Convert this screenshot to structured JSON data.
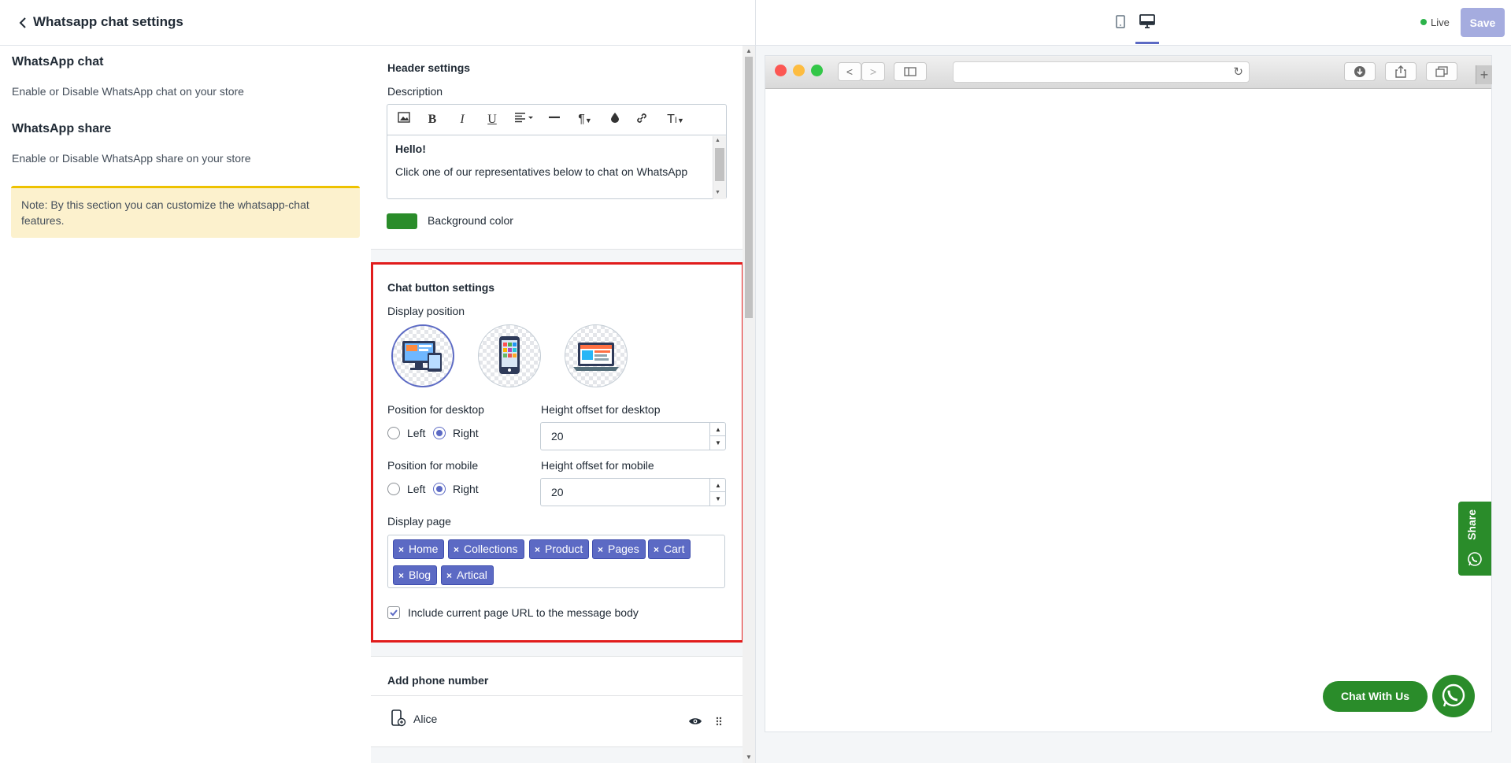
{
  "header": {
    "title": "Whatsapp chat settings",
    "live_label": "Live",
    "save_label": "Save"
  },
  "sidebar": {
    "chat_heading": "WhatsApp chat",
    "chat_desc": "Enable or Disable WhatsApp chat on your store",
    "share_heading": "WhatsApp share",
    "share_desc": "Enable or Disable WhatsApp share on your store",
    "note": "Note: By this section you can customize the whatsapp-chat features."
  },
  "header_settings": {
    "title": "Header settings",
    "description_label": "Description",
    "editor_line1": "Hello!",
    "editor_line2": "Click one of our representatives below to chat on WhatsApp",
    "bg_color_label": "Background color",
    "bg_color": "#2a8c2a"
  },
  "chat_button": {
    "title": "Chat button settings",
    "display_position_label": "Display position",
    "pos_desktop_label": "Position for desktop",
    "pos_mobile_label": "Position for mobile",
    "left_label": "Left",
    "right_label": "Right",
    "height_desktop_label": "Height offset for desktop",
    "height_desktop_value": "20",
    "height_mobile_label": "Height offset for mobile",
    "height_mobile_value": "20",
    "display_page_label": "Display page",
    "pages": [
      "Home",
      "Collections",
      "Product",
      "Pages",
      "Cart",
      "Blog",
      "Artical"
    ],
    "include_url_label": "Include current page URL to the message body"
  },
  "phone": {
    "title": "Add phone number",
    "entry_name": "Alice"
  },
  "preview": {
    "share_label": "Share",
    "chat_label": "Chat With Us"
  },
  "colors": {
    "accent": "#5c6ac4",
    "whatsapp_green": "#2a8c2a",
    "highlight_red": "#e11c1c"
  }
}
